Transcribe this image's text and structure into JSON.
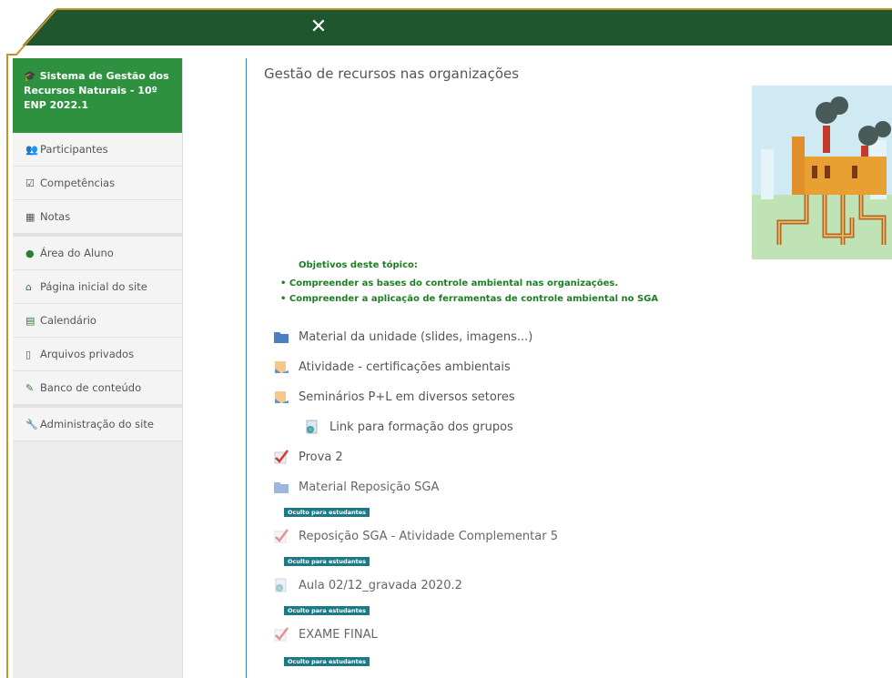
{
  "close_label": "✕",
  "sidebar": {
    "course_title": "Sistema de Gestão dos Recursos Naturais - 10º ENP 2022.1",
    "items": [
      {
        "label": "Participantes",
        "icon": "users-icon"
      },
      {
        "label": "Competências",
        "icon": "checkbox-icon"
      },
      {
        "label": "Notas",
        "icon": "table-icon"
      },
      {
        "label": "Área do Aluno",
        "icon": "group-icon"
      },
      {
        "label": "Página inicial do site",
        "icon": "home-icon"
      },
      {
        "label": "Calendário",
        "icon": "calendar-icon"
      },
      {
        "label": "Arquivos privados",
        "icon": "file-icon"
      },
      {
        "label": "Banco de conteúdo",
        "icon": "brush-icon"
      },
      {
        "label": "Administração do site",
        "icon": "wrench-icon"
      }
    ]
  },
  "main": {
    "title": "Gestão de recursos nas organizações",
    "objectives_title": "Objetivos deste tópico:",
    "objectives": [
      "• Compreender as bases do controle ambiental nas organizações.",
      "• Compreender a aplicação de ferramentas de controle ambiental no SGA"
    ],
    "activities": [
      {
        "label": "Material da unidade (slides, imagens...)",
        "icon": "folder-icon"
      },
      {
        "label": "Atividade - certificações ambientais",
        "icon": "assignment-icon"
      },
      {
        "label": "Seminários P+L em diversos setores",
        "icon": "assignment-icon"
      },
      {
        "label": "Link para formação dos grupos",
        "icon": "url-icon"
      },
      {
        "label": "Prova 2",
        "icon": "quiz-icon"
      },
      {
        "label": "Material Reposição SGA",
        "icon": "folder-icon"
      },
      {
        "label": "Reposição SGA - Atividade Complementar 5",
        "icon": "quiz-icon"
      },
      {
        "label": "Aula 02/12_gravada 2020.2",
        "icon": "video-icon"
      },
      {
        "label": "EXAME FINAL",
        "icon": "quiz-icon"
      }
    ],
    "hidden_badge": "Oculto para estudantes"
  },
  "colors": {
    "topbar": "#20562d",
    "course_header": "#2e9140",
    "objectives": "#1b7f22",
    "badge": "#1c7a86"
  }
}
